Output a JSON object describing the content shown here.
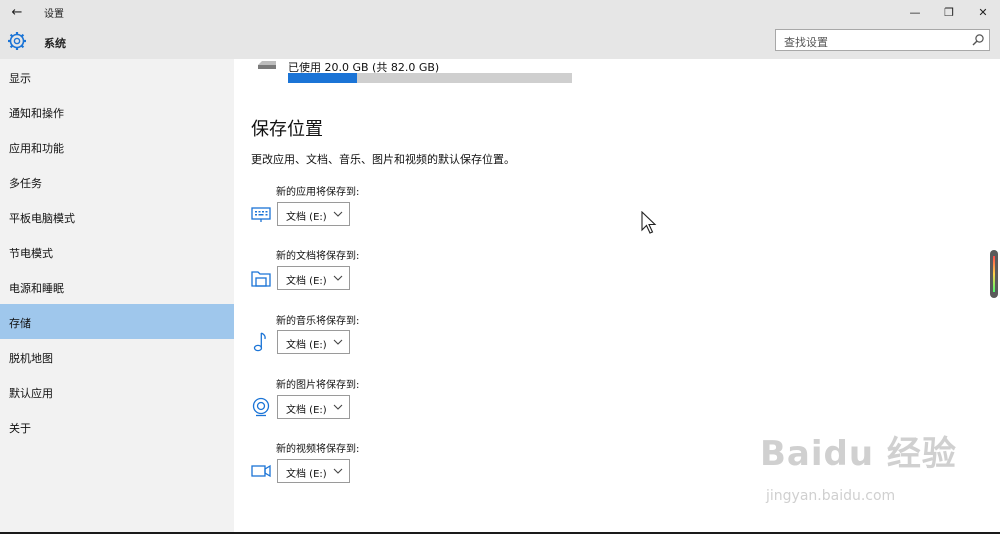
{
  "titlebar": {
    "back_icon": "←",
    "title": "设置",
    "minimize_icon": "—",
    "maximize_icon": "❐",
    "close_icon": "✕"
  },
  "header": {
    "title": "系统",
    "search_placeholder": "查找设置"
  },
  "sidebar": {
    "items": [
      {
        "label": "显示"
      },
      {
        "label": "通知和操作"
      },
      {
        "label": "应用和功能"
      },
      {
        "label": "多任务"
      },
      {
        "label": "平板电脑模式"
      },
      {
        "label": "节电模式"
      },
      {
        "label": "电源和睡眠"
      },
      {
        "label": "存储",
        "active": true
      },
      {
        "label": "脱机地图"
      },
      {
        "label": "默认应用"
      },
      {
        "label": "关于"
      }
    ]
  },
  "storage": {
    "usage_text": "已使用 20.0 GB (共 82.0 GB)",
    "used_fraction": 0.244
  },
  "save_locations": {
    "title": "保存位置",
    "description": "更改应用、文档、音乐、图片和视频的默认保存位置。",
    "rows": [
      {
        "label": "新的应用将保存到:",
        "icon": "app-icon",
        "value": "文档 (E:)"
      },
      {
        "label": "新的文档将保存到:",
        "icon": "document-folder-icon",
        "value": "文档 (E:)"
      },
      {
        "label": "新的音乐将保存到:",
        "icon": "music-icon",
        "value": "文档 (E:)"
      },
      {
        "label": "新的图片将保存到:",
        "icon": "camera-icon",
        "value": "文档 (E:)"
      },
      {
        "label": "新的视频将保存到:",
        "icon": "video-icon",
        "value": "文档 (E:)"
      }
    ]
  },
  "watermark": {
    "logo": "Baidu 经验",
    "url": "jingyan.baidu.com"
  },
  "colors": {
    "accent": "#1b74d6",
    "active_item": "#9fc7ec",
    "sidebar_bg": "#f2f2f2",
    "header_bg": "#e6e6e6"
  }
}
